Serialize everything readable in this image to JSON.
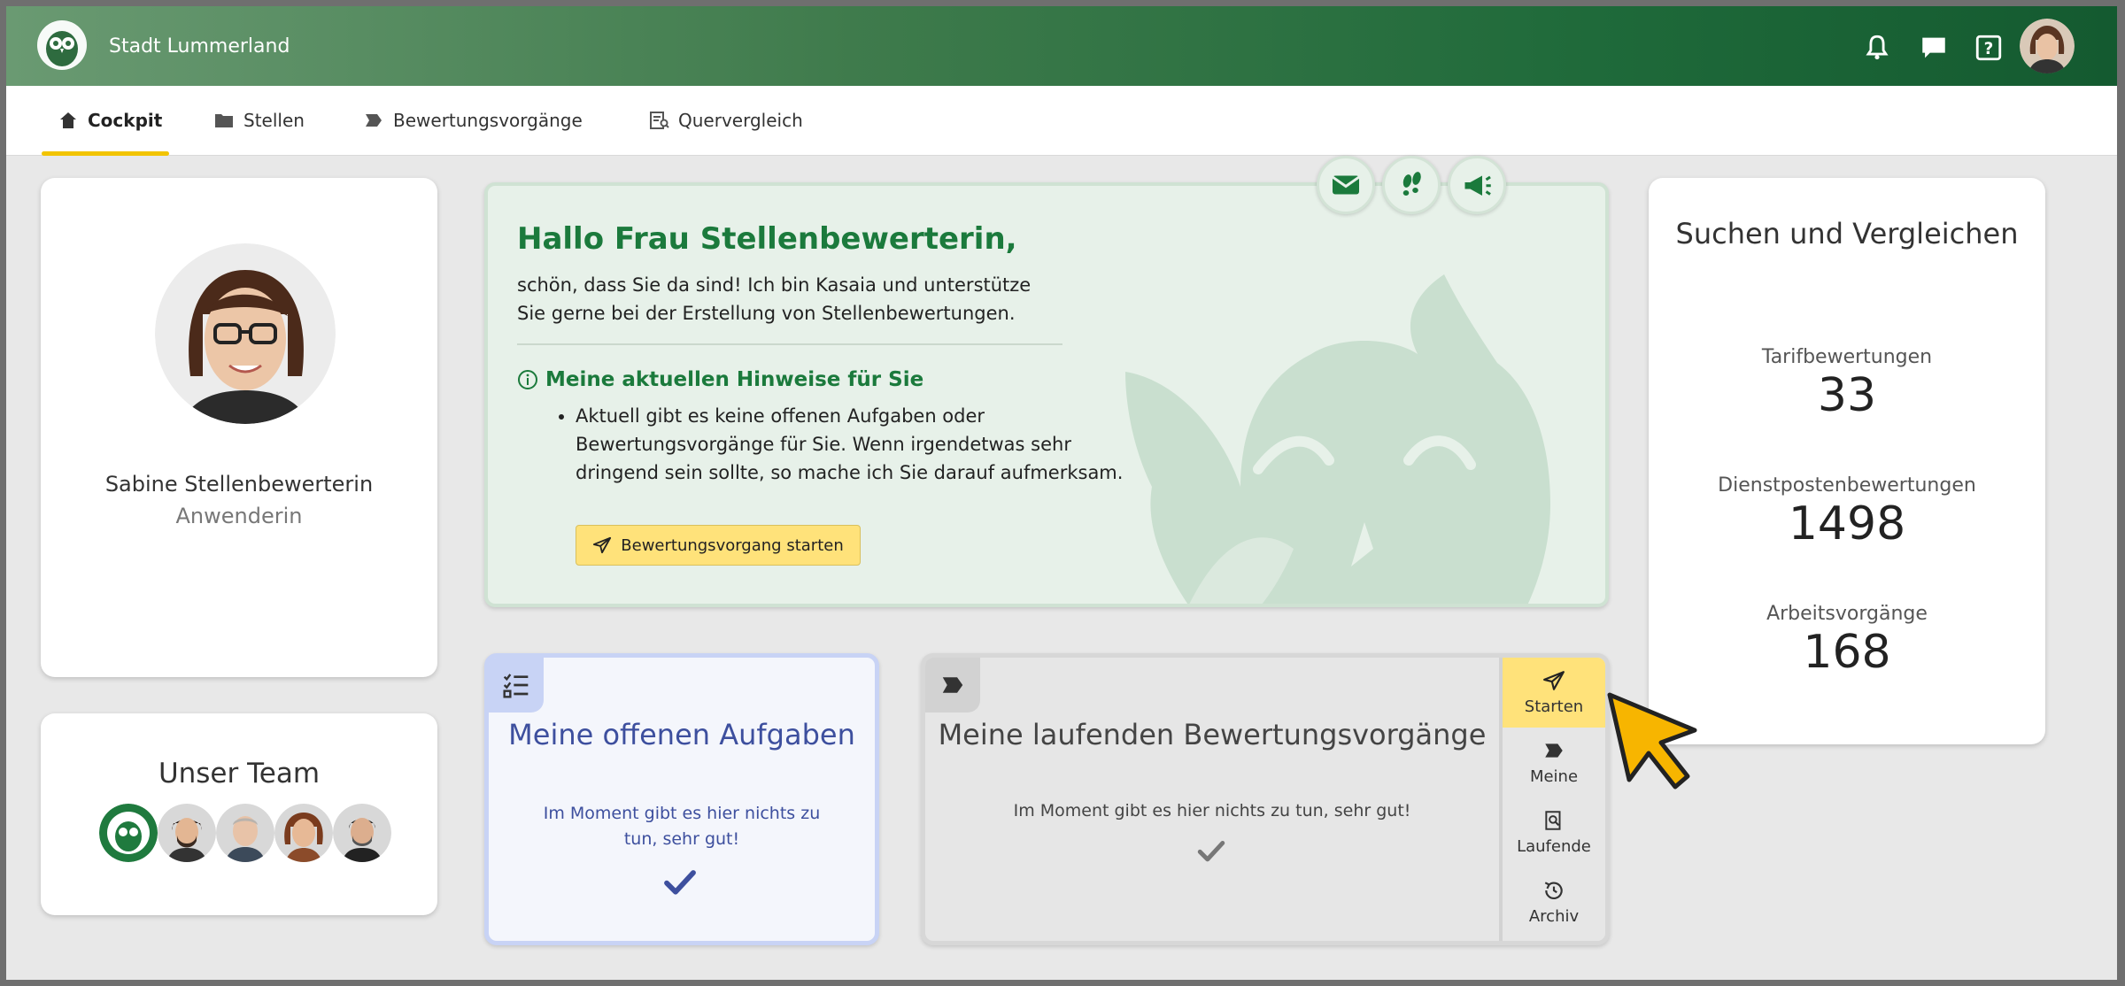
{
  "header": {
    "app_title": "Stadt Lummerland",
    "icons": [
      "bell-icon",
      "chat-icon",
      "help-icon",
      "user-avatar"
    ]
  },
  "nav": {
    "tabs": [
      {
        "label": "Cockpit",
        "icon": "home-icon",
        "active": true
      },
      {
        "label": "Stellen",
        "icon": "folder-icon",
        "active": false
      },
      {
        "label": "Bewertungsvorgänge",
        "icon": "process-icon",
        "active": false
      },
      {
        "label": "Quervergleich",
        "icon": "compare-icon",
        "active": false
      }
    ]
  },
  "profile": {
    "name": "Sabine Stellenbewerterin",
    "role": "Anwenderin"
  },
  "team": {
    "title": "Unser Team"
  },
  "welcome": {
    "title": "Hallo Frau Stellenbewerterin,",
    "text": "schön, dass Sie da sind! Ich bin Kasaia und unterstütze Sie gerne bei der Erstellung von Stellenbewertungen.",
    "hint_title": "Meine aktuellen Hinweise für Sie",
    "hint_item": "Aktuell gibt es keine offenen Aufgaben oder Bewertungsvorgänge für Sie. Wenn irgendetwas sehr dringend sein sollte, so mache ich Sie darauf aufmerksam.",
    "start_button": "Bewertungsvorgang starten",
    "action_icons": [
      "mail-icon",
      "footsteps-icon",
      "megaphone-icon"
    ]
  },
  "search": {
    "title": "Suchen und Vergleichen",
    "stats": [
      {
        "label": "Tarifbewertungen",
        "value": "33"
      },
      {
        "label": "Dienstpostenbewertungen",
        "value": "1498"
      },
      {
        "label": "Arbeitsvorgänge",
        "value": "168"
      }
    ]
  },
  "tasks": {
    "title": "Meine offenen Aufgaben",
    "text": "Im Moment gibt es hier nichts zu tun, sehr gut!"
  },
  "running": {
    "title": "Meine laufenden Bewertungsvorgänge",
    "text": "Im Moment gibt es hier nichts zu tun, sehr gut!",
    "side_items": [
      {
        "label": "Starten",
        "icon": "send-icon",
        "active": true
      },
      {
        "label": "Meine",
        "icon": "process-icon",
        "active": false
      },
      {
        "label": "Laufende",
        "icon": "search-doc-icon",
        "active": false
      },
      {
        "label": "Archiv",
        "icon": "history-icon",
        "active": false
      }
    ]
  },
  "colors": {
    "brand_green": "#1b7a3c",
    "accent_yellow": "#ffe27a",
    "tasks_blue": "#3d4f9e"
  }
}
